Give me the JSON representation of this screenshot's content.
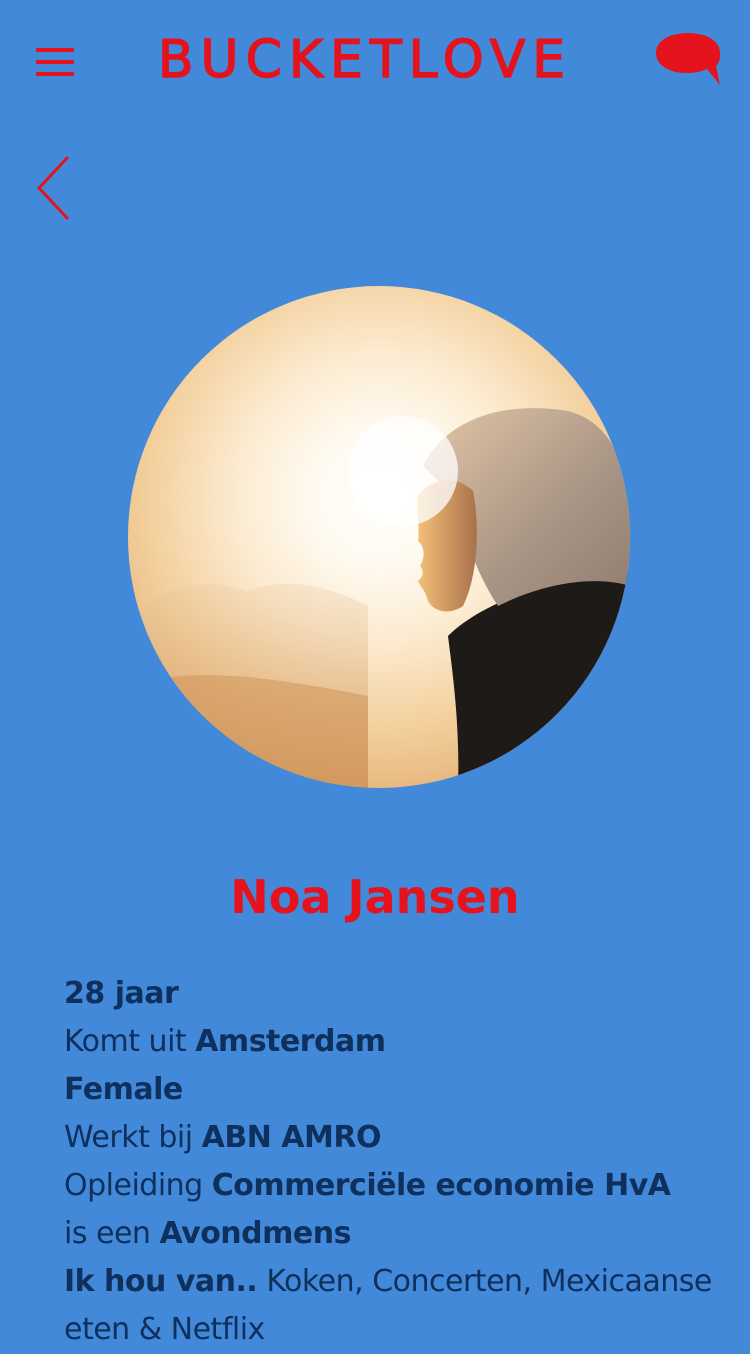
{
  "header": {
    "logo": "BUCKETLOVE",
    "menu_icon": "hamburger-menu-icon",
    "chat_icon": "speech-bubble-icon"
  },
  "nav": {
    "back_icon": "chevron-left-icon"
  },
  "profile": {
    "name": "Noa Jansen",
    "age": "28 jaar",
    "origin_prefix": "Komt uit",
    "origin_value": "Amsterdam",
    "gender": "Female",
    "work_prefix": "Werkt bij",
    "work_value": "ABN AMRO",
    "education_prefix": "Opleiding",
    "education_value": "Commerciële economie HvA",
    "type_prefix": "is een",
    "type_value": "Avondmens",
    "likes_prefix": "Ik hou van..",
    "likes_value": "Koken, Concerten, Mexicaanse eten & Netflix"
  },
  "colors": {
    "background": "#428ad9",
    "accent": "#e5131d",
    "text": "#0f2f5c"
  }
}
